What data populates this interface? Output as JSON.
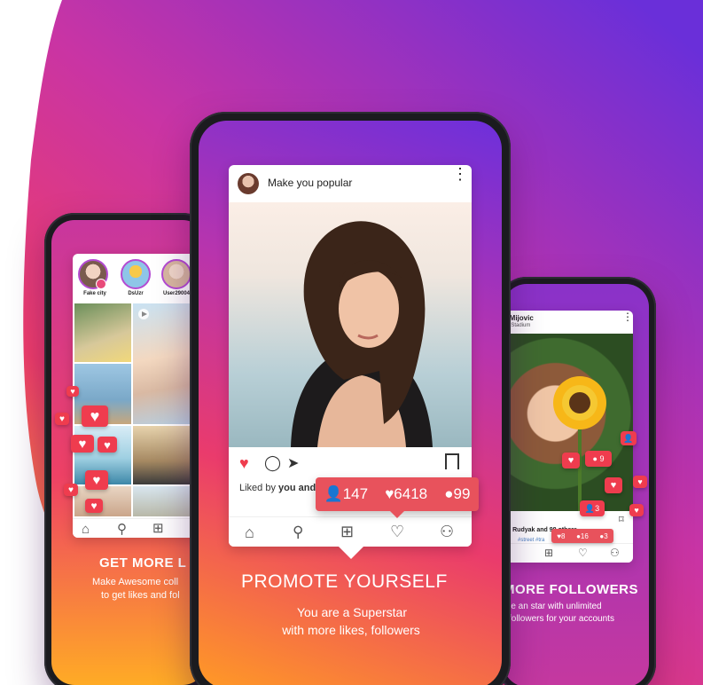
{
  "colors": {
    "gradient_top": "#7a2fd6",
    "gradient_mid": "#e2366b",
    "gradient_bottom": "#ffb020",
    "like_red": "#ef3c4e",
    "badge_red": "#e8525c"
  },
  "left_phone": {
    "stories": [
      {
        "label": "Fake city"
      },
      {
        "label": "DsUzr"
      },
      {
        "label": "User29004"
      }
    ],
    "heading": "GET MORE L",
    "sub_line1": "Make Awesome coll",
    "sub_line2": "to get likes and fol"
  },
  "center_phone": {
    "post_title": "Make you popular",
    "liked_by_prefix": "Liked by ",
    "liked_by_bold": "you and",
    "badge": {
      "followers": "147",
      "likes": "6418",
      "comments": "99"
    },
    "heading": "PROMOTE YOURSELF",
    "sub_line1": "You are a Superstar",
    "sub_line2": "with more likes, followers"
  },
  "right_phone": {
    "user_name": "a Mijovic",
    "location": "ng Stadium",
    "liked_text": "sh Rudyak and 98 others",
    "caption_prefix": "ic",
    "tags": "#street #tra",
    "badge": {
      "likes": "8",
      "comments": "16",
      "followers": "3"
    },
    "float_counts": [
      "9",
      "3"
    ],
    "heading": "MORE FOLLOWERS",
    "sub_line1": "me an star with unlimited",
    "sub_line2": "followers for your accounts"
  }
}
